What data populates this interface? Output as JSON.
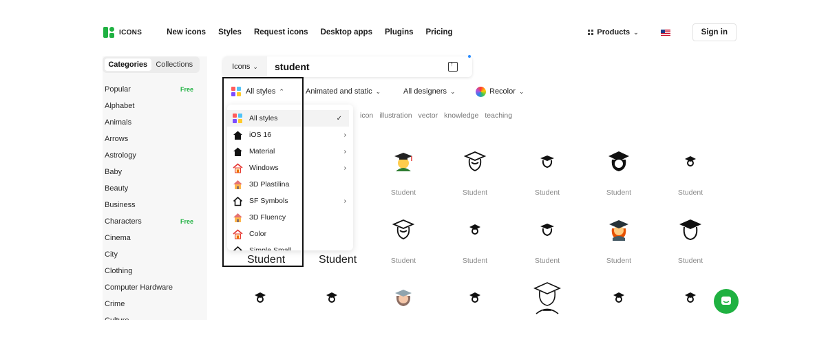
{
  "brand": {
    "logo_text": "ICONS",
    "accent": "#1fb141"
  },
  "nav": {
    "links": [
      "New icons",
      "Styles",
      "Request icons",
      "Desktop apps",
      "Plugins",
      "Pricing"
    ],
    "products_label": "Products",
    "signin_label": "Sign in"
  },
  "sidebar": {
    "tabs": [
      "Categories",
      "Collections"
    ],
    "categories": [
      {
        "label": "Popular",
        "badge": "Free"
      },
      {
        "label": "Alphabet",
        "badge": ""
      },
      {
        "label": "Animals",
        "badge": ""
      },
      {
        "label": "Arrows",
        "badge": ""
      },
      {
        "label": "Astrology",
        "badge": ""
      },
      {
        "label": "Baby",
        "badge": ""
      },
      {
        "label": "Beauty",
        "badge": ""
      },
      {
        "label": "Business",
        "badge": ""
      },
      {
        "label": "Characters",
        "badge": "Free"
      },
      {
        "label": "Cinema",
        "badge": ""
      },
      {
        "label": "City",
        "badge": ""
      },
      {
        "label": "Clothing",
        "badge": ""
      },
      {
        "label": "Computer Hardware",
        "badge": ""
      },
      {
        "label": "Crime",
        "badge": ""
      },
      {
        "label": "Culture",
        "badge": ""
      }
    ]
  },
  "search": {
    "type_label": "Icons",
    "query": "student"
  },
  "filters": {
    "styles_label": "All styles",
    "animated_label": "Animated and static",
    "designers_label": "All designers",
    "recolor_label": "Recolor"
  },
  "tags": [
    "icon",
    "illustration",
    "vector",
    "knowledge",
    "teaching"
  ],
  "dropdown": {
    "items": [
      {
        "label": "All styles",
        "right": "✓",
        "icon": "all-styles-icon"
      },
      {
        "label": "iOS 16",
        "right": "›",
        "icon": "house-filled-icon"
      },
      {
        "label": "Material",
        "right": "›",
        "icon": "house-filled-icon"
      },
      {
        "label": "Windows",
        "right": "›",
        "icon": "house-color-icon"
      },
      {
        "label": "3D Plastilina",
        "right": "",
        "icon": "house-3d-icon"
      },
      {
        "label": "SF Symbols",
        "right": "›",
        "icon": "house-outline-icon"
      },
      {
        "label": "3D Fluency",
        "right": "",
        "icon": "house-3d-icon"
      },
      {
        "label": "Color",
        "right": "",
        "icon": "house-color-icon"
      },
      {
        "label": "Simple Small",
        "right": "",
        "icon": "house-outline-icon"
      }
    ]
  },
  "grid": {
    "label": "Student",
    "row1": [
      "student-emoji-icon",
      "student-outline-icon",
      "student-small-icon",
      "student-filled-icon",
      "student-tiny-icon"
    ],
    "row2": [
      "student-outline-icon",
      "student-tiny-icon",
      "student-small-icon",
      "student-color-icon",
      "student-filled-outline-icon"
    ],
    "row3": [
      "student-tiny-icon",
      "student-tiny-icon",
      "student-3d-icon",
      "student-tiny-icon",
      "student-illustration-icon",
      "student-tiny-icon",
      "student-tiny-icon"
    ]
  }
}
